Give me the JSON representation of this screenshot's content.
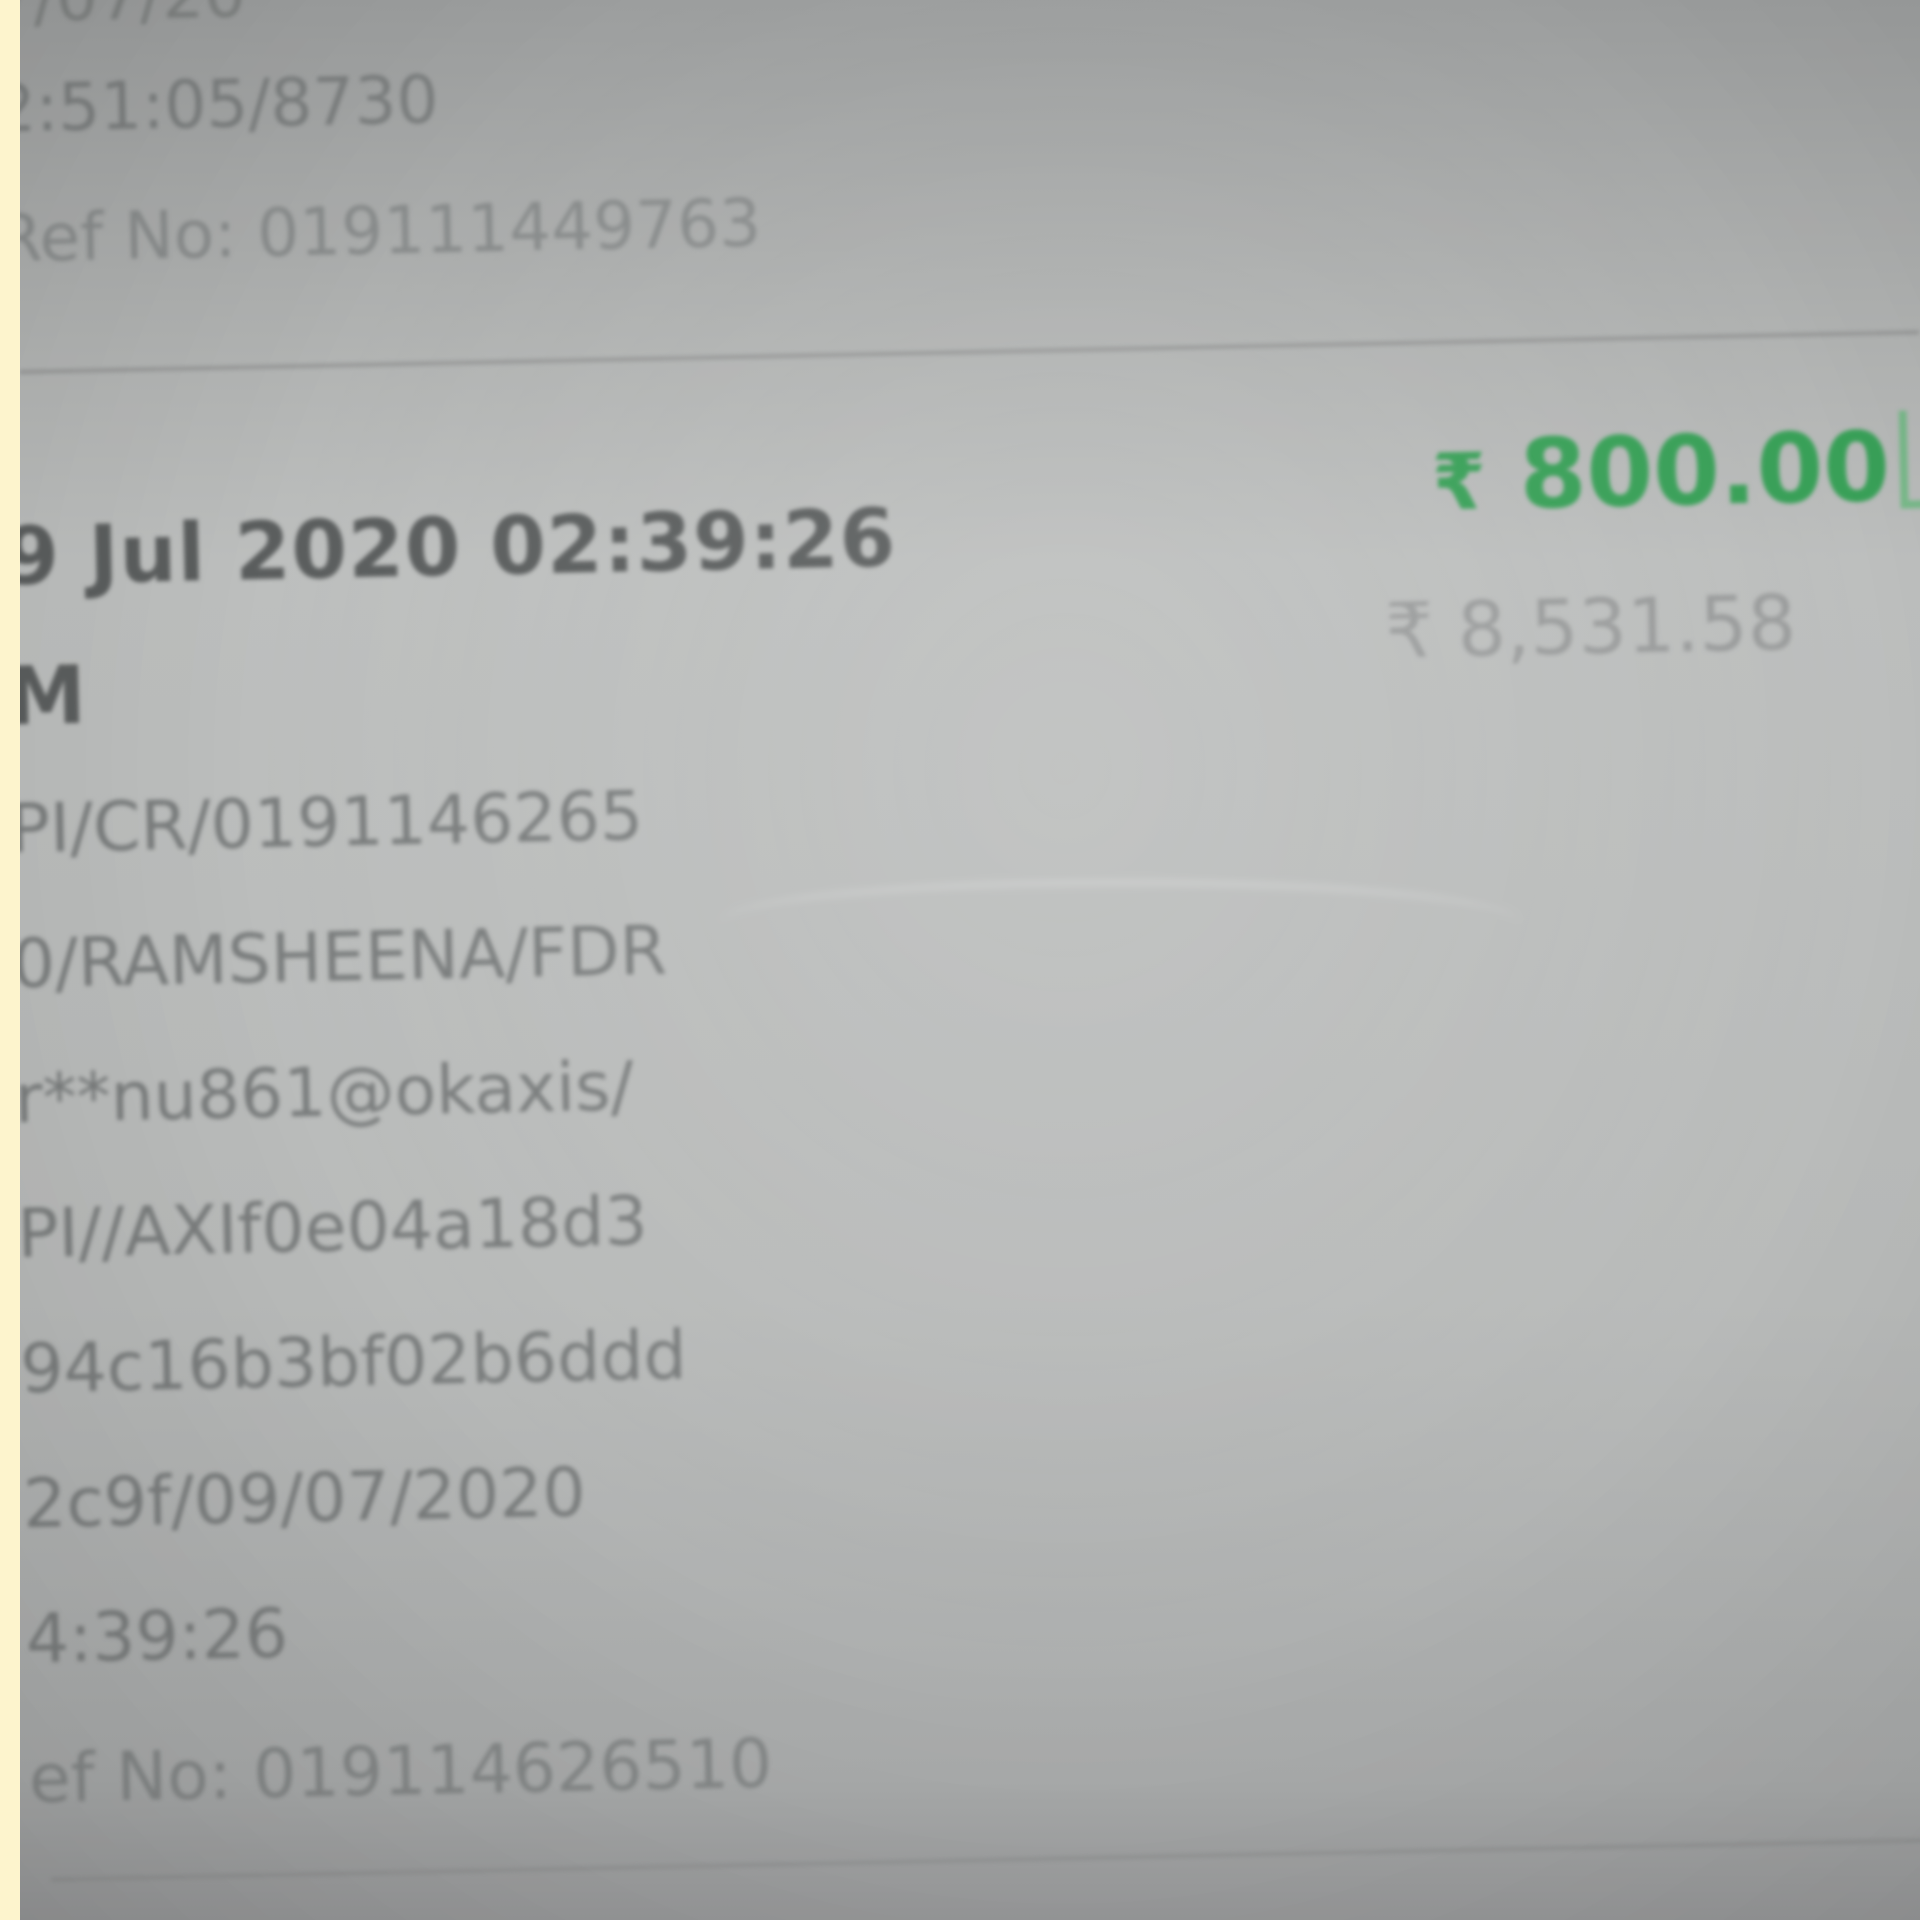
{
  "previous_entry": {
    "line1": "7/07/20",
    "line2": "2:51:05/8730",
    "line3": "Ref No: 019111449763"
  },
  "transaction": {
    "datetime": "9 Jul 2020 02:39:26",
    "type": "M",
    "description_lines": [
      "PI/CR/0191146265",
      "0/RAMSHEENA/FDR",
      "r**nu861@okaxis/",
      "PI//AXIf0e04a18d3",
      "94c16b3bf02b6ddd",
      "2c9f/09/07/2020",
      "4:39:26",
      "ef No: 019114626510"
    ],
    "amount": {
      "currency": "₹",
      "value": "800.00",
      "color": "#39a058"
    },
    "balance": {
      "currency": "₹",
      "value": "8,531.58"
    },
    "status_icon": "credit-indicator-icon"
  }
}
